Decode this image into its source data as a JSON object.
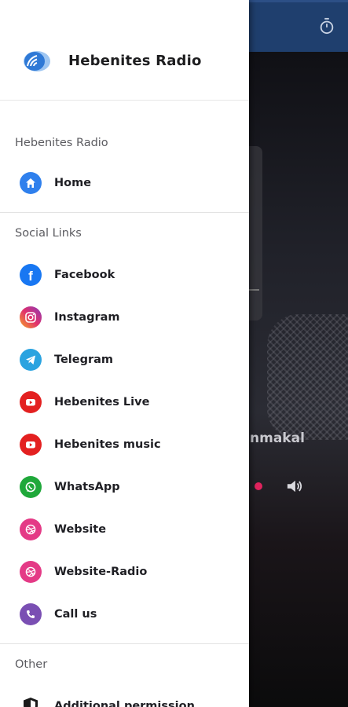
{
  "app": {
    "title": "Hebenites Radio"
  },
  "drawer": {
    "sections": [
      {
        "title": "Hebenites Radio",
        "items": [
          {
            "label": "Home",
            "icon": "home-icon"
          }
        ]
      },
      {
        "title": "Social Links",
        "items": [
          {
            "label": "Facebook",
            "icon": "facebook-icon"
          },
          {
            "label": "Instagram",
            "icon": "instagram-icon"
          },
          {
            "label": "Telegram",
            "icon": "telegram-icon"
          },
          {
            "label": "Hebenites Live",
            "icon": "youtube-icon"
          },
          {
            "label": "Hebenites music",
            "icon": "youtube-icon"
          },
          {
            "label": "WhatsApp",
            "icon": "whatsapp-icon"
          },
          {
            "label": "Website",
            "icon": "dribbble-icon"
          },
          {
            "label": "Website-Radio",
            "icon": "dribbble-icon"
          },
          {
            "label": "Call us",
            "icon": "viber-icon"
          }
        ]
      },
      {
        "title": "Other",
        "items": [
          {
            "label": "Additional permission",
            "icon": "shield-icon"
          }
        ]
      }
    ]
  },
  "background": {
    "now_playing_fragment": "nmakal",
    "timer_icon": "timer-icon",
    "volume_icon": "volume-icon"
  },
  "colors": {
    "appbar": "#1f3f6e",
    "home": "#2f80ed",
    "facebook": "#1877f2",
    "instagram": "#e1306c",
    "telegram": "#2aa3e0",
    "youtube": "#e32020",
    "whatsapp": "#1fa83a",
    "website": "#e43a86",
    "viber": "#7a4fb3"
  }
}
